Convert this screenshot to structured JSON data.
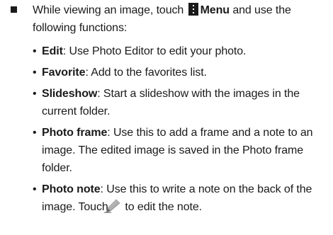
{
  "intro": {
    "before_icon": "While viewing an image, touch",
    "menu_label": "Menu",
    "after_label": "and use the following functions:"
  },
  "items": [
    {
      "title": "Edit",
      "text": ": Use Photo Editor to edit your photo."
    },
    {
      "title": "Favorite",
      "text": ": Add to the favorites list."
    },
    {
      "title": "Slideshow",
      "text": ": Start a slideshow with the images in the current folder."
    },
    {
      "title": "Photo frame",
      "text": ": Use this to add a frame and a note to an image. The edited image is saved in the Photo frame folder."
    },
    {
      "title": "Photo note",
      "text": ": Use this to write a note on the back of the image. Touch",
      "text_after_icon": "to edit the note."
    }
  ],
  "icons": {
    "main_bullet": "square-bullet",
    "menu": "menu-icon",
    "edit_note": "pencil-icon"
  }
}
